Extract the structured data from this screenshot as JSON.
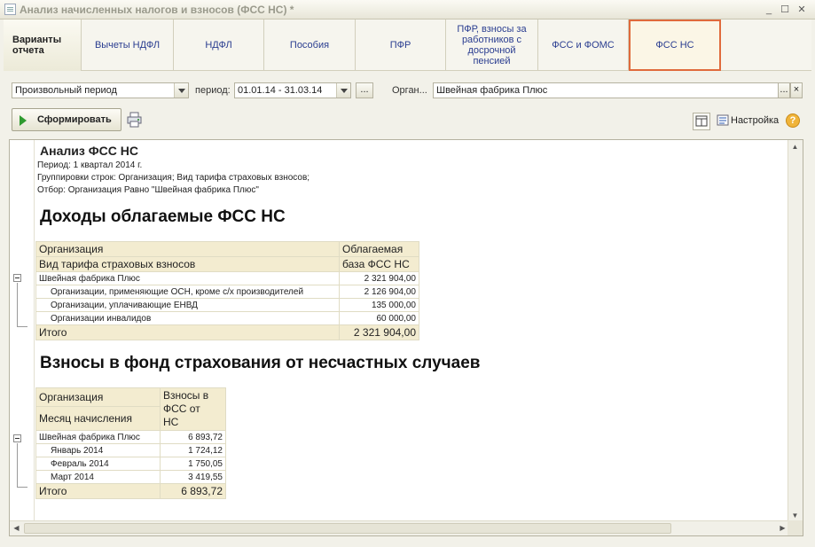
{
  "window": {
    "title": "Анализ начисленных налогов и взносов (ФСС НС) *"
  },
  "tabs": [
    {
      "label": "Варианты отчета"
    },
    {
      "label": "Вычеты НДФЛ"
    },
    {
      "label": "НДФЛ"
    },
    {
      "label": "Пособия"
    },
    {
      "label": "ПФР"
    },
    {
      "label": "ПФР, взносы за работников с досрочной пенсией"
    },
    {
      "label": "ФСС и ФОМС"
    },
    {
      "label": "ФСС НС"
    }
  ],
  "params": {
    "period_type": "Произвольный период",
    "period_label": "период:",
    "period_value": "01.01.14 - 31.03.14",
    "org_label": "Орган...",
    "org_value": "Швейная фабрика Плюс",
    "more_btn": "...",
    "clear_btn": "×"
  },
  "toolbar": {
    "generate": "Сформировать",
    "settings": "Настройка",
    "help": "?"
  },
  "report": {
    "title": "Анализ ФСС НС",
    "period": "Период: 1 квартал 2014 г.",
    "grouping": "Группировки строк: Организация; Вид тарифа страховых взносов;",
    "filter": "Отбор: Организация Равно \"Швейная фабрика Плюс\"",
    "section1": {
      "heading": "Доходы облагаемые ФСС НС",
      "col1a": "Организация",
      "col1b": "Вид тарифа страховых взносов",
      "col2a": "Облагаемая",
      "col2b": "база ФСС НС",
      "group_name": "Швейная фабрика Плюс",
      "group_value": "2 321 904,00",
      "rows": [
        {
          "name": "Организации, применяющие ОСН, кроме с/х производителей",
          "value": "2 126 904,00"
        },
        {
          "name": "Организации, уплачивающие ЕНВД",
          "value": "135 000,00"
        },
        {
          "name": "Организации инвалидов",
          "value": "60 000,00"
        }
      ],
      "total_label": "Итого",
      "total_value": "2 321 904,00"
    },
    "section2": {
      "heading": "Взносы в фонд страхования от несчастных случаев",
      "col1a": "Организация",
      "col1b": "Месяц начисления",
      "col2a": "Взносы в",
      "col2b": "ФСС от",
      "col2c": "НС",
      "group_name": "Швейная фабрика Плюс",
      "group_value": "6 893,72",
      "rows": [
        {
          "name": "Январь 2014",
          "value": "1 724,12"
        },
        {
          "name": "Февраль 2014",
          "value": "1 750,05"
        },
        {
          "name": "Март 2014",
          "value": "3 419,55"
        }
      ],
      "total_label": "Итого",
      "total_value": "6 893,72"
    }
  }
}
